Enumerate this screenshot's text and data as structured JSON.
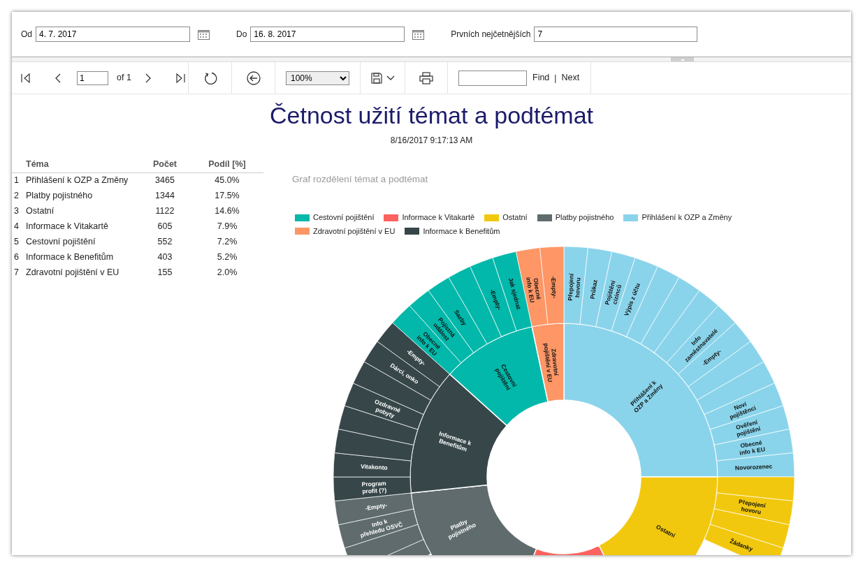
{
  "parameters": [
    {
      "kind": "date",
      "label": "Od",
      "value": "4. 7. 2017"
    },
    {
      "kind": "date",
      "label": "Do",
      "value": "16. 8. 2017"
    },
    {
      "kind": "number",
      "label": "Prvních nejčetnějších",
      "value": "7"
    }
  ],
  "toolbar": {
    "page": "1",
    "page_count": "of 1",
    "zoom": "100%",
    "find_button": "Find",
    "separator": "|",
    "next_button": "Next"
  },
  "report": {
    "title": "Četnost užití témat a podtémat",
    "timestamp": "8/16/2017 9:17:13 AM",
    "table": {
      "columns": [
        "Téma",
        "Počet",
        "Podíl [%]"
      ],
      "rows": [
        {
          "rank": "1",
          "topic": "Přihlášení k OZP a Změny",
          "count": "3465",
          "share": "45.0%"
        },
        {
          "rank": "2",
          "topic": "Platby pojistného",
          "count": "1344",
          "share": "17.5%"
        },
        {
          "rank": "3",
          "topic": "Ostatní",
          "count": "1122",
          "share": "14.6%"
        },
        {
          "rank": "4",
          "topic": "Informace k Vitakartě",
          "count": "605",
          "share": "7.9%"
        },
        {
          "rank": "5",
          "topic": "Cestovní pojištění",
          "count": "552",
          "share": "7.2%"
        },
        {
          "rank": "6",
          "topic": "Informace k Benefitům",
          "count": "403",
          "share": "5.2%"
        },
        {
          "rank": "7",
          "topic": "Zdravotní pojištění v EU",
          "count": "155",
          "share": "2.0%"
        }
      ]
    },
    "chart": {
      "title": "Graf rozdělení témat a podtémat",
      "legend": [
        {
          "label": "Cestovní pojištění",
          "color": "#01b8aa"
        },
        {
          "label": "Informace k Vitakartě",
          "color": "#fd625e"
        },
        {
          "label": "Ostatní",
          "color": "#f2c80f"
        },
        {
          "label": "Platby pojistného",
          "color": "#5f6b6d"
        },
        {
          "label": "Přihlášení k OZP a Změny",
          "color": "#8ad4eb"
        },
        {
          "label": "Zdravotní pojištění v EU",
          "color": "#fe9666"
        },
        {
          "label": "Informace k Benefitům",
          "color": "#374649"
        }
      ],
      "sunburst": [
        {
          "label": "Přihlášení k OZP a Změny",
          "color": "#8ad4eb",
          "children": [
            {
              "kind": "labeled",
              "label": "Přepojení hovoru"
            },
            {
              "kind": "labeled",
              "label": "Průkaz"
            },
            {
              "kind": "labeled",
              "label": "Pojištění cizinců"
            },
            {
              "kind": "labeled",
              "label": "Výpis z účtu"
            },
            {
              "kind": "blank"
            },
            {
              "kind": "blank"
            },
            {
              "kind": "blank"
            },
            {
              "kind": "labeled",
              "label": "Info zaměstnavatelé"
            },
            {
              "kind": "labeled",
              "label": "-Empty-"
            },
            {
              "kind": "blank"
            },
            {
              "kind": "blank"
            },
            {
              "kind": "labeled",
              "label": "Noví pojištěnci"
            },
            {
              "kind": "labeled",
              "label": "Ověření pojištění"
            },
            {
              "kind": "labeled",
              "label": "Obecné info k EU"
            },
            {
              "kind": "labeled",
              "label": "Novorozenec"
            }
          ]
        },
        {
          "label": "Ostatní",
          "color": "#f2c80f",
          "children": [
            {
              "kind": "blank"
            },
            {
              "kind": "labeled",
              "label": "Přepojení hovoru"
            },
            {
              "kind": "blank"
            },
            {
              "kind": "labeled",
              "label": "Žádanky"
            }
          ]
        },
        {
          "color": "#fd625e"
        },
        {
          "label": "Platby pojistného",
          "color": "#5f6b6d",
          "children": [
            {
              "kind": "blank"
            },
            {
              "kind": "blank"
            },
            {
              "kind": "labeled",
              "label": "Info k přehledu OSVČ"
            },
            {
              "kind": "labeled",
              "label": "-Empty-"
            }
          ]
        },
        {
          "label": "Informace k Benefitům",
          "color": "#374649",
          "children": [
            {
              "kind": "labeled",
              "label": "Program profit (?)"
            },
            {
              "kind": "labeled",
              "label": "Vitakonto"
            },
            {
              "kind": "blank"
            },
            {
              "kind": "blank"
            },
            {
              "kind": "labeled",
              "label": "Ozdravné pobyty"
            },
            {
              "kind": "blank"
            },
            {
              "kind": "labeled",
              "label": "Dárci, onko"
            },
            {
              "kind": "labeled",
              "label": "-Empty-"
            }
          ]
        },
        {
          "label": "Cestovní pojištění",
          "color": "#01b8aa",
          "children": [
            {
              "kind": "labeled",
              "label": "Obecné info k EU"
            },
            {
              "kind": "labeled",
              "label": "Pojistná událost"
            },
            {
              "kind": "labeled",
              "label": "Sazby"
            },
            {
              "kind": "blank"
            },
            {
              "kind": "labeled",
              "label": "-Empty-"
            },
            {
              "kind": "labeled",
              "label": "Jak sjednat"
            }
          ]
        },
        {
          "label": "Zdravotní pojištění v EU",
          "color": "#fe9666",
          "children": [
            {
              "kind": "labeled",
              "label": "Obecné info k EU"
            },
            {
              "kind": "labeled",
              "label": "-Empty-"
            }
          ]
        }
      ]
    }
  }
}
